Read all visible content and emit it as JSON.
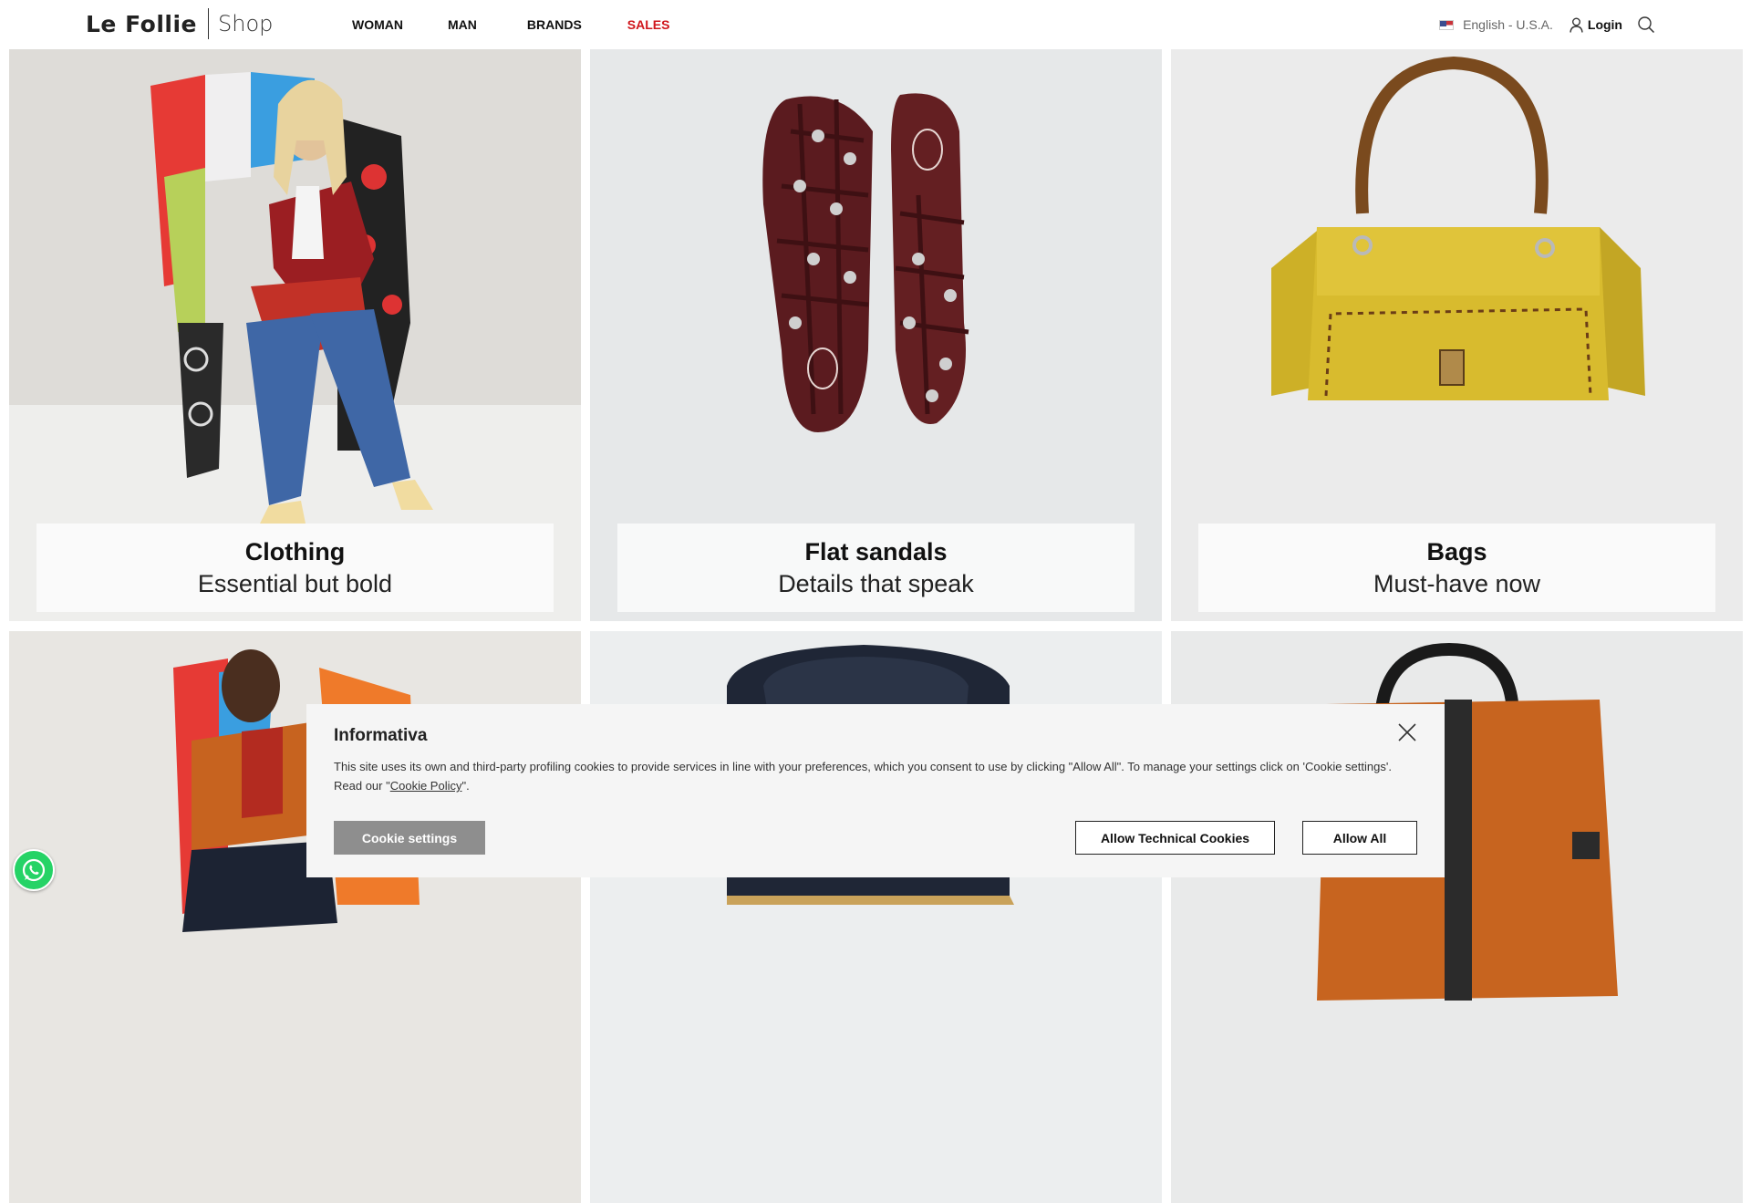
{
  "brand": {
    "name": "Le Follie",
    "sub": "Shop"
  },
  "nav": [
    {
      "label": "WOMAN"
    },
    {
      "label": "MAN"
    },
    {
      "label": "BRANDS"
    },
    {
      "label": "SALES",
      "color": "#d0161c"
    }
  ],
  "tools": {
    "language": "English - U.S.A.",
    "login": "Login",
    "icons": [
      "flag-usa-icon",
      "user-icon",
      "search-icon"
    ]
  },
  "tiles": [
    {
      "title": "Clothing",
      "subtitle": "Essential but bold"
    },
    {
      "title": "Flat sandals",
      "subtitle": "Details that speak"
    },
    {
      "title": "Bags",
      "subtitle": "Must-have now"
    }
  ],
  "cookie": {
    "title": "Informativa",
    "text_before": "This site uses its own and third-party profiling cookies to provide services in line with your preferences, which you consent to use by clicking \"Allow All\". To manage your settings click on 'Cookie settings'. Read our \"",
    "link": "Cookie Policy",
    "text_after": "\".",
    "settings_label": "Cookie settings",
    "technical_label": "Allow Technical Cookies",
    "all_label": "Allow All"
  },
  "colors": {
    "accent_sales": "#d0161c",
    "whatsapp": "#25d366",
    "cookie_bg": "#f5f5f5",
    "settings_btn": "#8e8e8e"
  }
}
